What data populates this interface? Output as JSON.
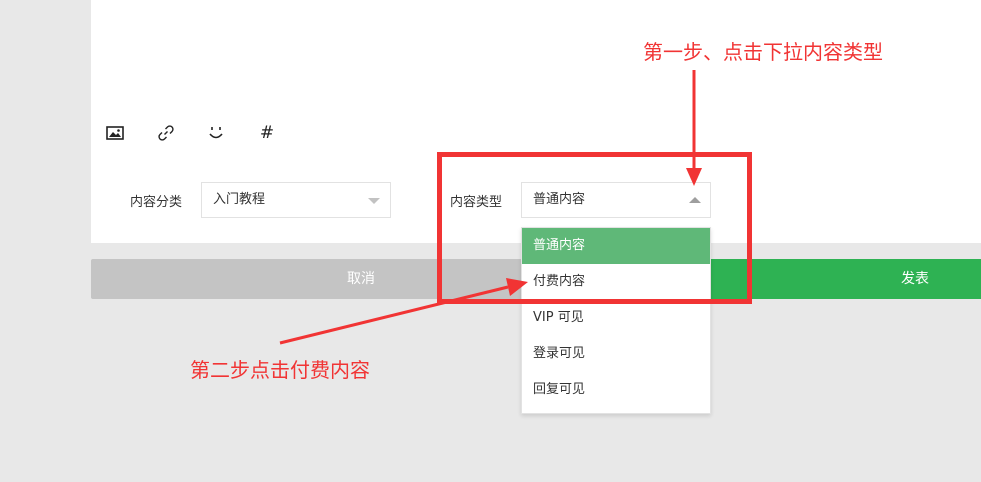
{
  "toolbar": {
    "icons": [
      "image-icon",
      "link-icon",
      "emoji-icon",
      "hash-icon"
    ],
    "hash_glyph": "#"
  },
  "form": {
    "category_label": "内容分类",
    "category_value": "入门教程",
    "type_label": "内容类型",
    "type_value": "普通内容"
  },
  "dropdown": {
    "options": [
      "普通内容",
      "付费内容",
      "VIP 可见",
      "登录可见",
      "回复可见"
    ],
    "selected_index": 0
  },
  "buttons": {
    "cancel": "取消",
    "publish": "发表"
  },
  "annotations": {
    "step1": "第一步、点击下拉内容类型",
    "step2": "第二步点击付费内容"
  },
  "colors": {
    "annotation_red": "#f13434",
    "publish_green": "#2eb253",
    "selected_green": "#5fb878",
    "cancel_gray": "#c4c4c4"
  }
}
